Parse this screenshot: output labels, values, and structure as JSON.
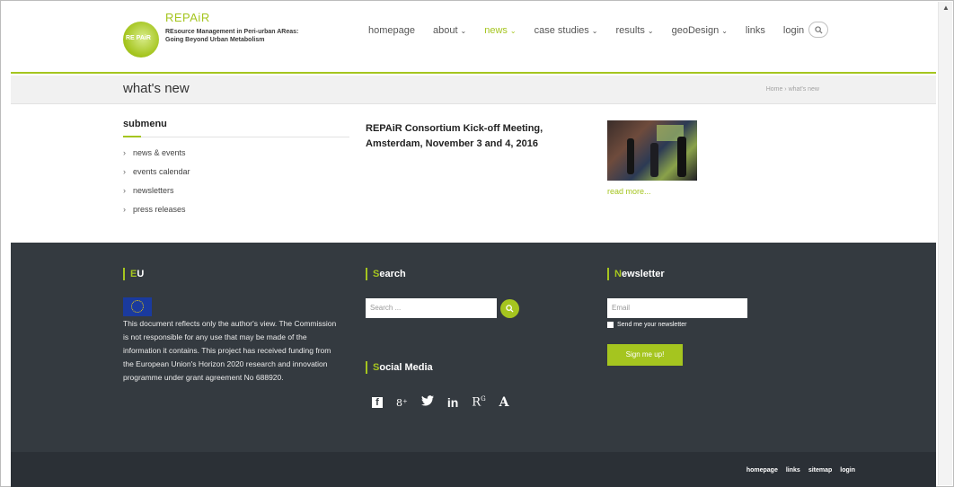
{
  "header": {
    "logo_name": "REPAiR",
    "logo_tagline": "REsource Management in Peri-urban AReas: Going Beyond Urban Metabolism",
    "logo_badge": "RE PAiR",
    "nav": [
      {
        "label": "homepage",
        "caret": ""
      },
      {
        "label": "about",
        "caret": "⌄"
      },
      {
        "label": "news",
        "caret": "⌄"
      },
      {
        "label": "case studies",
        "caret": "⌄"
      },
      {
        "label": "results",
        "caret": "⌄"
      },
      {
        "label": "geoDesign",
        "caret": "⌄"
      },
      {
        "label": "links",
        "caret": ""
      },
      {
        "label": "login",
        "caret": ""
      }
    ],
    "active_nav": "news",
    "search_icon": "search-icon"
  },
  "titlebar": {
    "title": "what's new",
    "breadcrumb": "Home  ›  what's new"
  },
  "submenu": {
    "heading": "submenu",
    "items": [
      "news & events",
      "events calendar",
      "newsletters",
      "press releases"
    ]
  },
  "news": {
    "title": "REPAiR Consortium Kick-off Meeting, Amsterdam, November 3 and 4, 2016",
    "read_more": "read more..."
  },
  "footer": {
    "eu_heading_hl": "E",
    "eu_heading_rest": "U",
    "eu_text": "This document reflects only the author's view. The Commission is not responsible for any use that may be made of the information it contains. This project has received funding from the European Union's Horizon 2020 research and innovation programme under grant agreement No 688920.",
    "search_heading_hl": "S",
    "search_heading_rest": "earch",
    "search_placeholder": "Search ...",
    "social_heading_hl": "S",
    "social_heading_rest": "ocial Media",
    "social_icons": [
      "facebook-icon",
      "googleplus-icon",
      "twitter-icon",
      "linkedin-icon",
      "researchgate-icon",
      "academia-icon"
    ],
    "newsletter_heading_hl": "N",
    "newsletter_heading_rest": "ewsletter",
    "email_placeholder": "Email",
    "checkbox_label": "Send me your newsletter",
    "signup_label": "Sign me up!",
    "bottom_links": [
      "homepage",
      "links",
      "sitemap",
      "login"
    ]
  },
  "colors": {
    "accent": "#a5c51f",
    "footer": "#343a40",
    "bottom": "#2b3036"
  }
}
